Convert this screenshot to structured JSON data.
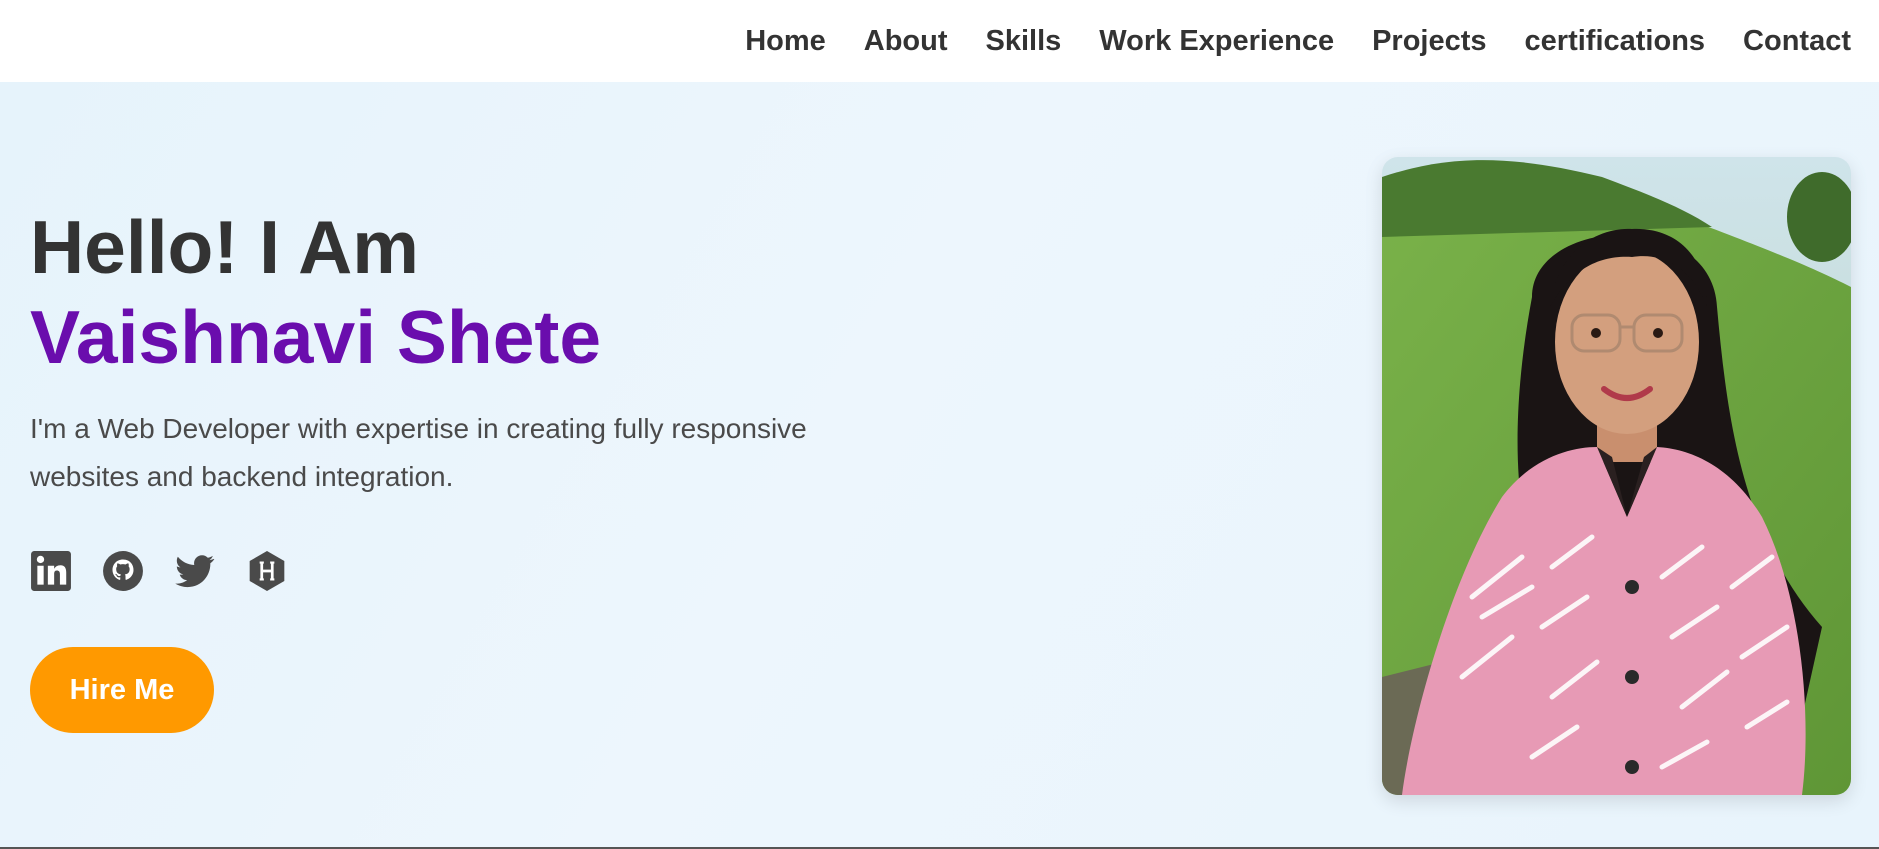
{
  "nav": {
    "items": [
      {
        "label": "Home"
      },
      {
        "label": "About"
      },
      {
        "label": "Skills"
      },
      {
        "label": "Work Experience"
      },
      {
        "label": "Projects"
      },
      {
        "label": "certifications"
      },
      {
        "label": "Contact"
      }
    ]
  },
  "hero": {
    "greeting": "Hello! I Am",
    "name": "Vaishnavi Shete",
    "bio": "I'm a Web Developer with expertise in creating fully responsive websites and backend integration.",
    "socials": [
      {
        "icon": "linkedin-icon"
      },
      {
        "icon": "github-icon"
      },
      {
        "icon": "twitter-icon"
      },
      {
        "icon": "hashnode-icon"
      }
    ],
    "cta_label": "Hire Me",
    "photo_icon": "profile-photo"
  },
  "colors": {
    "accent_name": "#6a0dad",
    "cta": "#ff9900",
    "text": "#333333",
    "hero_bg": "#e8f4fc"
  }
}
